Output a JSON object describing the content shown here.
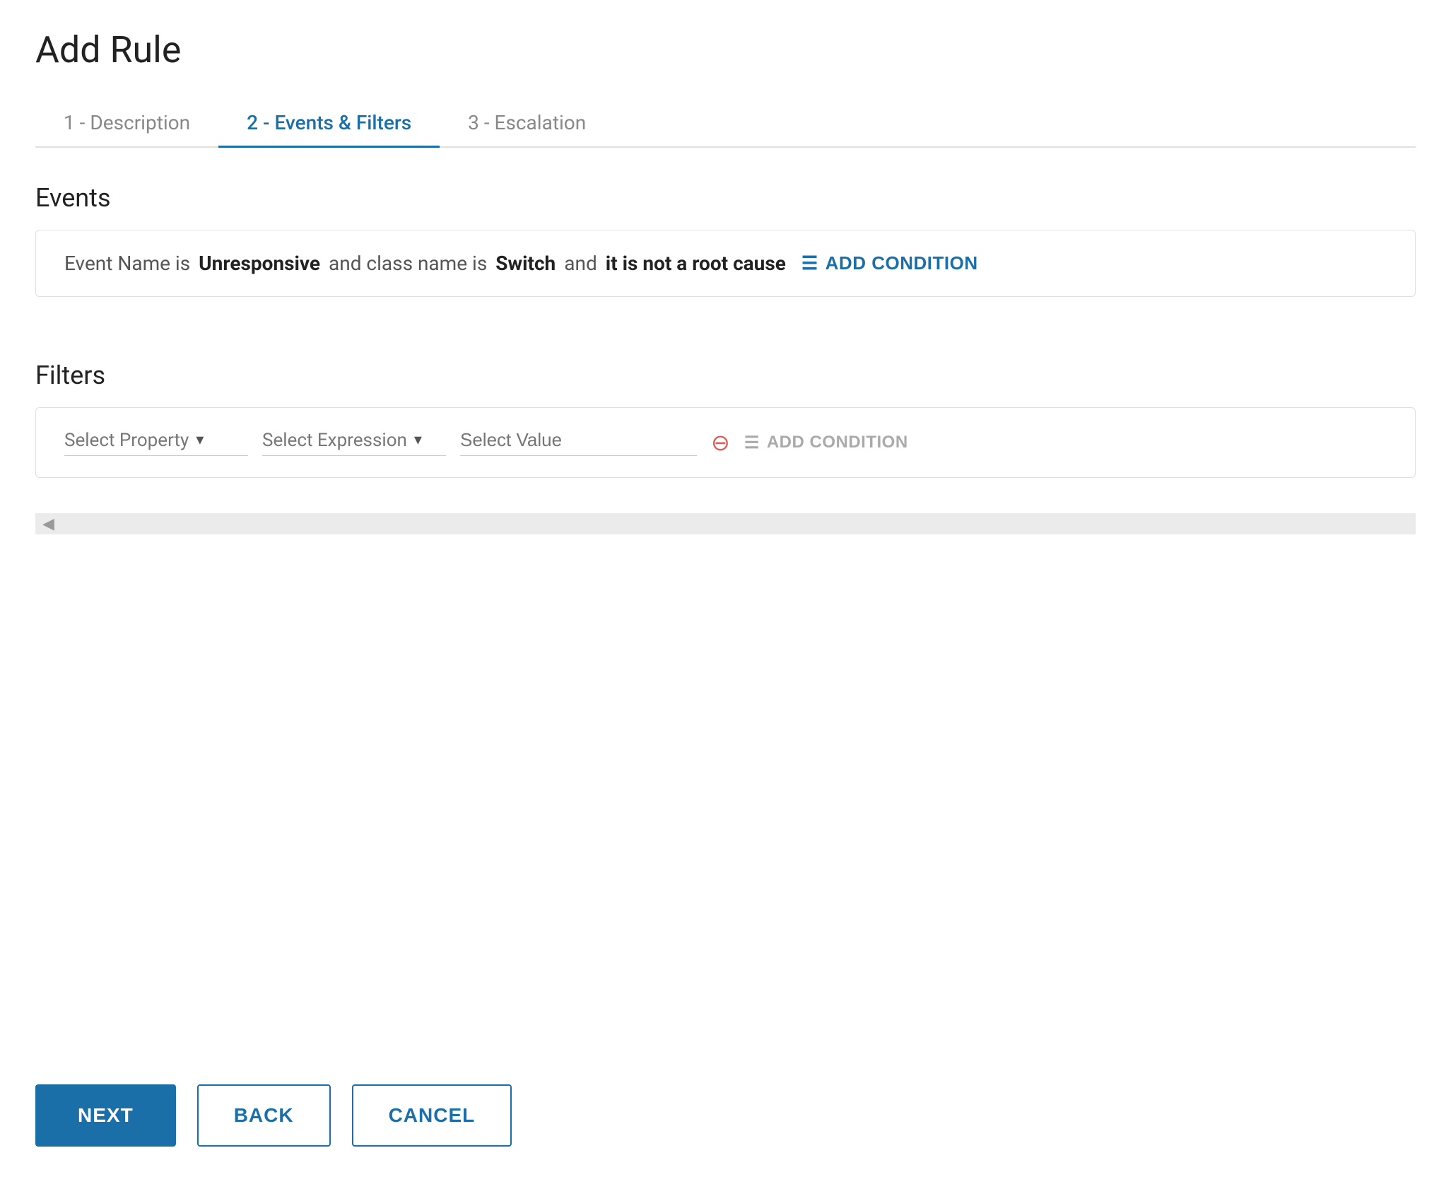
{
  "page": {
    "title": "Add Rule"
  },
  "tabs": [
    {
      "id": "tab-description",
      "label": "1 - Description",
      "active": false
    },
    {
      "id": "tab-events-filters",
      "label": "2 - Events & Filters",
      "active": true
    },
    {
      "id": "tab-escalation",
      "label": "3 - Escalation",
      "active": false
    }
  ],
  "events_section": {
    "title": "Events",
    "conditions": [
      {
        "prefix": "Event Name is",
        "value": "Unresponsive"
      },
      {
        "prefix": "and class name is",
        "value": "Switch"
      },
      {
        "prefix": "and",
        "value": "it is not a root cause"
      }
    ],
    "add_condition_label": "ADD CONDITION"
  },
  "filters_section": {
    "title": "Filters",
    "select_property_label": "Select Property",
    "select_expression_label": "Select Expression",
    "select_value_placeholder": "Select Value",
    "add_condition_label": "ADD CONDITION"
  },
  "buttons": {
    "next_label": "NEXT",
    "back_label": "BACK",
    "cancel_label": "CANCEL"
  },
  "icons": {
    "chevron_down": "▾",
    "add_condition": "☰",
    "remove_circle": "⊖",
    "scroll_left": "◀"
  }
}
